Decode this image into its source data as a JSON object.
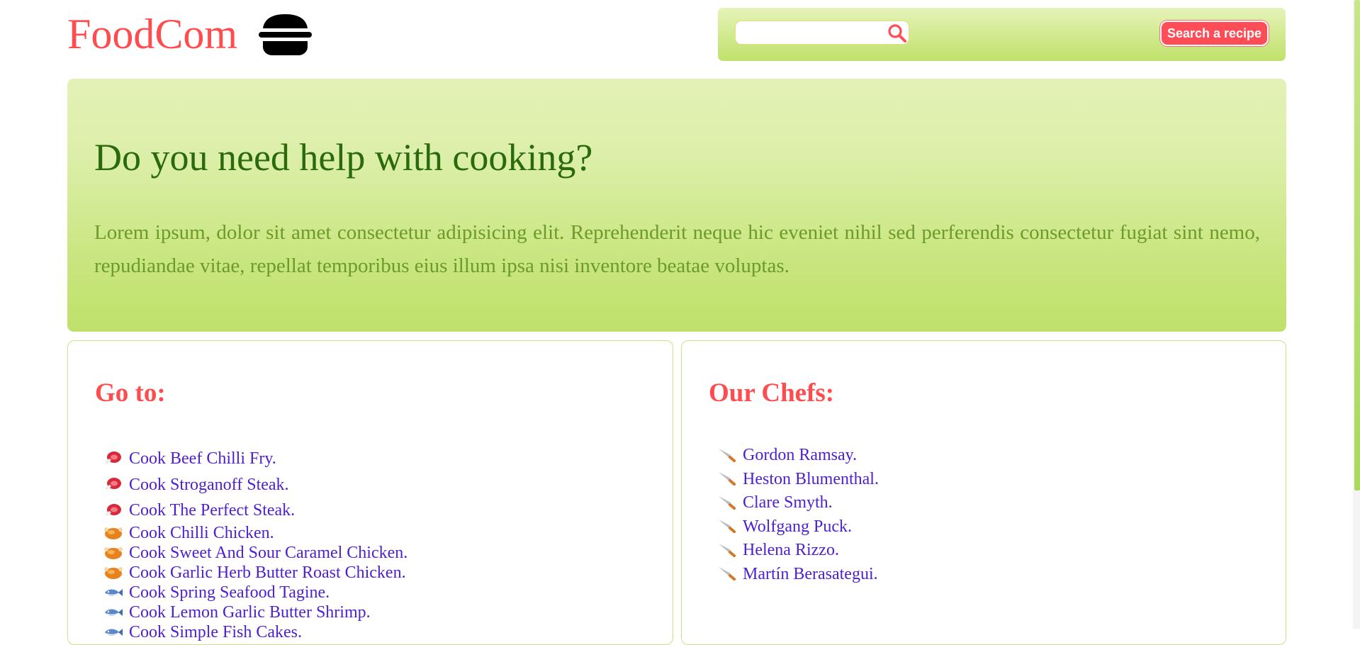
{
  "header": {
    "logo": "FoodCom",
    "logo_icon": "burger-icon",
    "search": {
      "placeholder": "",
      "value": "",
      "icon": "search-icon"
    },
    "search_button": "Search a recipe"
  },
  "hero": {
    "title": "Do you need help with cooking?",
    "text": "Lorem ipsum, dolor sit amet consectetur adipisicing elit. Reprehenderit neque hic eveniet nihil sed perferendis consectetur fugiat sint nemo, repudiandae vitae, repellat temporibus eius illum ipsa nisi inventore beatae voluptas."
  },
  "goto": {
    "title": "Go to:",
    "items": [
      {
        "label": "Cook Beef Chilli Fry.",
        "icon": "meat-icon"
      },
      {
        "label": "Cook Stroganoff Steak.",
        "icon": "meat-icon"
      },
      {
        "label": "Cook The Perfect Steak.",
        "icon": "meat-icon"
      },
      {
        "label": "Cook Chilli Chicken.",
        "icon": "roast-chicken-icon"
      },
      {
        "label": "Cook Sweet And Sour Caramel Chicken.",
        "icon": "roast-chicken-icon"
      },
      {
        "label": "Cook Garlic Herb Butter Roast Chicken.",
        "icon": "roast-chicken-icon"
      },
      {
        "label": "Cook Spring Seafood Tagine.",
        "icon": "fish-icon"
      },
      {
        "label": "Cook Lemon Garlic Butter Shrimp.",
        "icon": "fish-icon"
      },
      {
        "label": "Cook Simple Fish Cakes.",
        "icon": "fish-icon"
      }
    ]
  },
  "chefs": {
    "title": "Our Chefs:",
    "items": [
      {
        "label": "Gordon Ramsay.",
        "icon": "knife-icon"
      },
      {
        "label": "Heston Blumenthal.",
        "icon": "knife-icon"
      },
      {
        "label": "Clare Smyth.",
        "icon": "knife-icon"
      },
      {
        "label": "Wolfgang Puck.",
        "icon": "knife-icon"
      },
      {
        "label": "Helena Rizzo.",
        "icon": "knife-icon"
      },
      {
        "label": "Martín Berasategui.",
        "icon": "knife-icon"
      }
    ]
  },
  "colors": {
    "brand": "#ff4d4f",
    "accent_green": "#bfe16a",
    "link": "#4d1fd1",
    "hero_title": "#2b6a0c",
    "hero_text": "#6d9a2a"
  }
}
